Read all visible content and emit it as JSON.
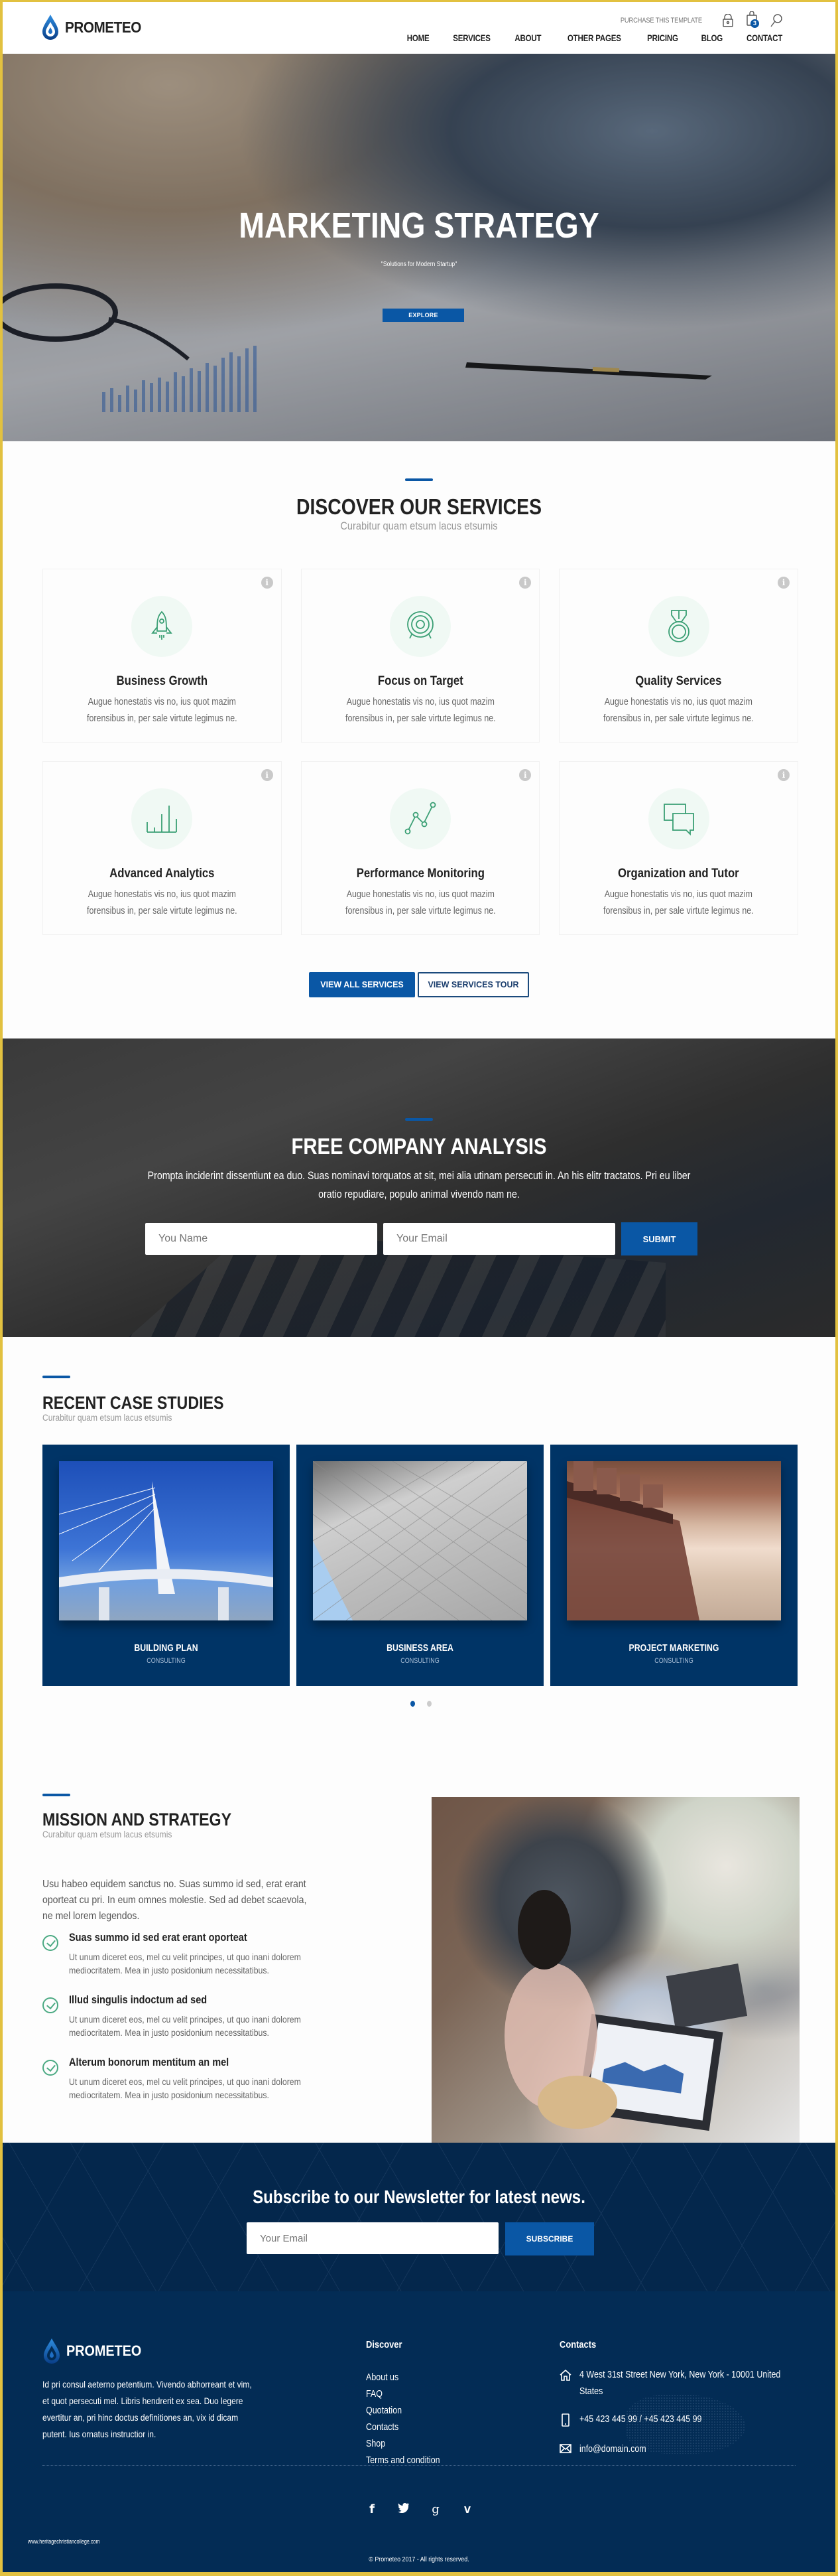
{
  "brand": {
    "name": "PROMETEO",
    "accent": "#0a57a5",
    "dark_navy": "#032c55",
    "green_icon": "#3a9f74"
  },
  "header": {
    "purchase_label": "PURCHASE THIS TEMPLATE",
    "cart_count": "3",
    "icons": [
      "lock-icon",
      "cart-icon",
      "search-icon"
    ],
    "nav": [
      {
        "label": "HOME"
      },
      {
        "label": "SERVICES"
      },
      {
        "label": "ABOUT"
      },
      {
        "label": "OTHER PAGES"
      },
      {
        "label": "PRICING"
      },
      {
        "label": "BLOG"
      },
      {
        "label": "CONTACT"
      }
    ]
  },
  "hero": {
    "title": "MARKETING STRATEGY",
    "subtitle": "\"Solutions for Modern Startup\"",
    "button": "EXPLORE"
  },
  "services": {
    "title": "DISCOVER OUR SERVICES",
    "subtitle": "Curabitur quam etsum lacus etsumis",
    "items": [
      {
        "icon": "rocket-icon",
        "title": "Business Growth",
        "text": "Augue honestatis vis no, ius quot mazim forensibus in, per sale virtute legimus ne."
      },
      {
        "icon": "target-icon",
        "title": "Focus on Target",
        "text": "Augue honestatis vis no, ius quot mazim forensibus in, per sale virtute legimus ne."
      },
      {
        "icon": "medal-icon",
        "title": "Quality Services",
        "text": "Augue honestatis vis no, ius quot mazim forensibus in, per sale virtute legimus ne."
      },
      {
        "icon": "bar-chart-icon",
        "title": "Advanced Analytics",
        "text": "Augue honestatis vis no, ius quot mazim forensibus in, per sale virtute legimus ne."
      },
      {
        "icon": "line-graph-icon",
        "title": "Performance Monitoring",
        "text": "Augue honestatis vis no, ius quot mazim forensibus in, per sale virtute legimus ne."
      },
      {
        "icon": "chat-bubbles-icon",
        "title": "Organization and Tutor",
        "text": "Augue honestatis vis no, ius quot mazim forensibus in, per sale virtute legimus ne."
      }
    ],
    "info_glyph": "i",
    "btn_all": "VIEW ALL SERVICES",
    "btn_tour": "VIEW SERVICES TOUR"
  },
  "analysis": {
    "title": "FREE COMPANY ANALYSIS",
    "text": "Prompta inciderint dissentiunt ea duo. Suas nominavi torquatos at sit, mei alia utinam persecuti in. An his elitr tractatos. Pri eu liber oratio repudiare, populo animal vivendo nam ne.",
    "name_placeholder": "You Name",
    "email_placeholder": "Your Email",
    "submit": "SUBMIT"
  },
  "cases": {
    "title": "RECENT CASE STUDIES",
    "subtitle": "Curabitur quam etsum lacus etsumis",
    "items": [
      {
        "title": "BUILDING PLAN",
        "category": "CONSULTING"
      },
      {
        "title": "BUSINESS AREA",
        "category": "CONSULTING"
      },
      {
        "title": "PROJECT MARKETING",
        "category": "CONSULTING"
      }
    ],
    "pages": 2,
    "active_page": 1
  },
  "mission": {
    "title": "MISSION AND STRATEGY",
    "subtitle": "Curabitur quam etsum lacus etsumis",
    "text": "Usu habeo equidem sanctus no. Suas summo id sed, erat erant oporteat cu pri. In eum omnes molestie. Sed ad debet scaevola, ne mel lorem legendos.",
    "features": [
      {
        "title": "Suas summo id sed erat erant oporteat",
        "text": "Ut unum diceret eos, mel cu velit principes, ut quo inani dolorem mediocritatem. Mea in justo posidonium necessitatibus."
      },
      {
        "title": "Illud singulis indoctum ad sed",
        "text": "Ut unum diceret eos, mel cu velit principes, ut quo inani dolorem mediocritatem. Mea in justo posidonium necessitatibus."
      },
      {
        "title": "Alterum bonorum mentitum an mel",
        "text": "Ut unum diceret eos, mel cu velit principes, ut quo inani dolorem mediocritatem. Mea in justo posidonium necessitatibus."
      }
    ]
  },
  "newsletter": {
    "title": "Subscribe to our Newsletter for latest news.",
    "placeholder": "Your Email",
    "button": "SUBSCRIBE"
  },
  "footer": {
    "about": "Id pri consul aeterno petentium. Vivendo abhorreant et vim, et quot persecuti mel. Libris hendrerit ex sea. Duo legere evertitur an, pri hinc doctus definitiones an, vix id dicam putent. Ius ornatus instructior in.",
    "discover_title": "Discover",
    "discover_links": [
      "About us",
      "FAQ",
      "Quotation",
      "Contacts",
      "Shop",
      "Terms and condition"
    ],
    "contacts_title": "Contacts",
    "address": "4 West 31st Street New York, New York - 10001 United States",
    "phone": "+45 423 445 99 / +45 423 445 99",
    "email": "info@domain.com",
    "social": [
      {
        "name": "facebook",
        "glyph": "f"
      },
      {
        "name": "twitter",
        "glyph": "t"
      },
      {
        "name": "google-plus",
        "glyph": "g"
      },
      {
        "name": "vimeo",
        "glyph": "v"
      }
    ],
    "watermark": "www.heritagechristiancollege.com",
    "copyright": "© Prometeo 2017 - All rights reserved."
  }
}
